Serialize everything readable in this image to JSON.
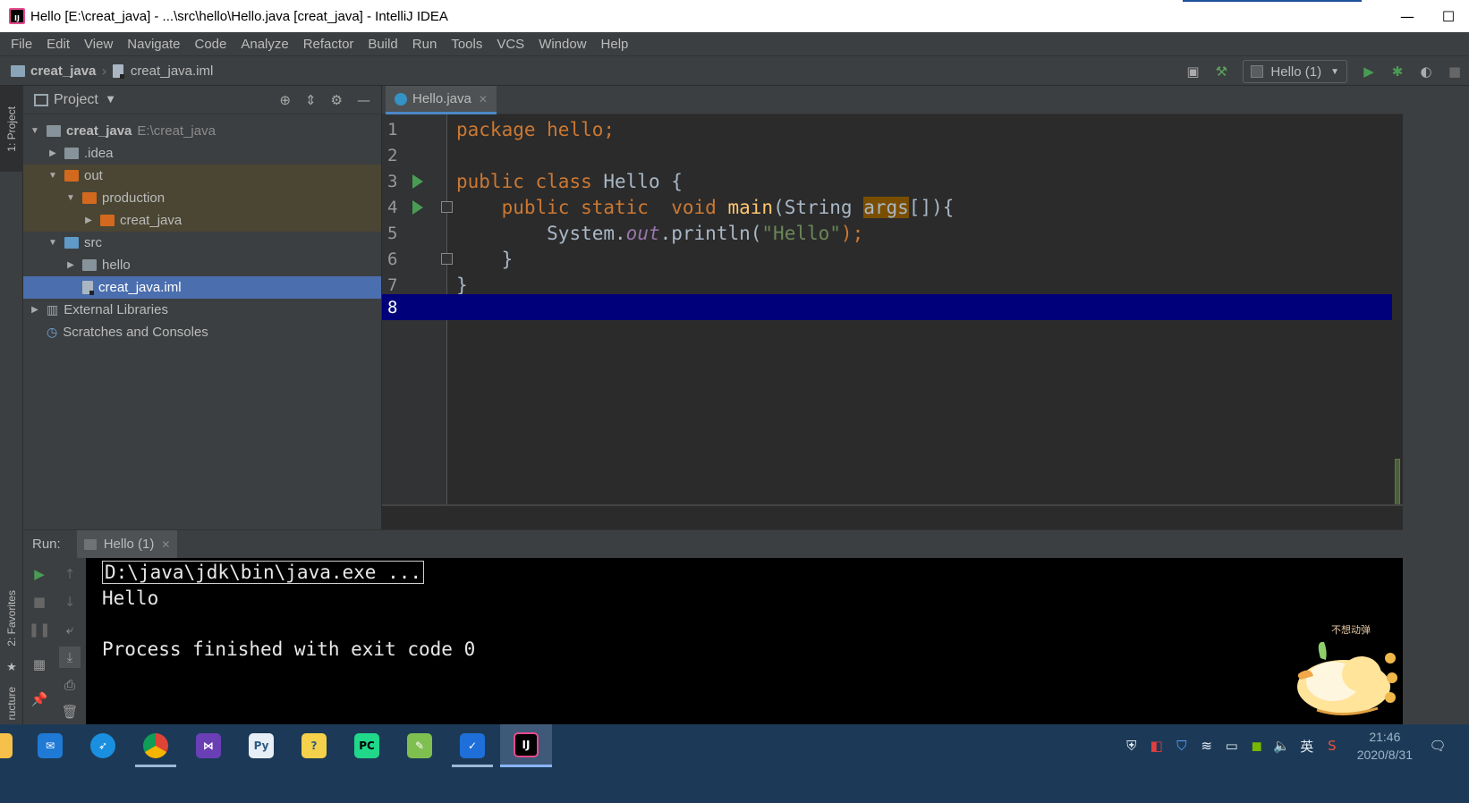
{
  "window": {
    "title": "Hello [E:\\creat_java] - ...\\src\\hello\\Hello.java [creat_java] - IntelliJ IDEA",
    "app_icon_text": "IJ",
    "minimize": "—",
    "maximize": "☐"
  },
  "menu": [
    "File",
    "Edit",
    "View",
    "Navigate",
    "Code",
    "Analyze",
    "Refactor",
    "Build",
    "Run",
    "Tools",
    "VCS",
    "Window",
    "Help"
  ],
  "navbar": {
    "crumb_project": "creat_java",
    "crumb_file": "creat_java.iml",
    "run_config": "Hello (1)"
  },
  "left_strip": {
    "project_tab": "1: Project",
    "favorites_tab": "2: Favorites",
    "structure_tab": "ructure"
  },
  "project_panel": {
    "title": "Project",
    "tree": [
      {
        "label": "creat_java",
        "path": "E:\\creat_java"
      },
      {
        "label": ".idea"
      },
      {
        "label": "out"
      },
      {
        "label": "production"
      },
      {
        "label": "creat_java"
      },
      {
        "label": "src"
      },
      {
        "label": "hello"
      },
      {
        "label": "creat_java.iml"
      },
      {
        "label": "External Libraries"
      },
      {
        "label": "Scratches and Consoles"
      }
    ]
  },
  "editor": {
    "tab_label": "Hello.java",
    "line_numbers": [
      "1",
      "2",
      "3",
      "4",
      "5",
      "6",
      "7",
      "8"
    ],
    "code": {
      "l1_kw": "package",
      "l1_rest": " hello;",
      "l3_kw1": "public",
      "l3_kw2": "class",
      "l3_rest": " Hello {",
      "l4_kw1": "public",
      "l4_kw2": "static",
      "l4_kw3": "void",
      "l4_mth": "main",
      "l4_mid": "(String ",
      "l4_arg": "args",
      "l4_end": "[]){",
      "l5_pre": "System.",
      "l5_fld": "out",
      "l5_mid": ".println(",
      "l5_str": "\"Hello\"",
      "l5_end": ");",
      "l6": "}",
      "l7": "}"
    }
  },
  "run_panel": {
    "label": "Run:",
    "tab_label": "Hello (1)",
    "console": [
      "D:\\java\\jdk\\bin\\java.exe ...",
      "Hello",
      "",
      "Process finished with exit code 0"
    ],
    "mascot_text": "不想动弹"
  },
  "taskbar": {
    "ime": "英",
    "time": "21:46",
    "date": "2020/8/31"
  },
  "colors": {
    "editor_bg": "#2b2b2b",
    "panel_bg": "#3c3f41",
    "keyword": "#cc7832",
    "string": "#6a8759",
    "selection": "#4b6eaf",
    "current_line": "#00007a"
  }
}
